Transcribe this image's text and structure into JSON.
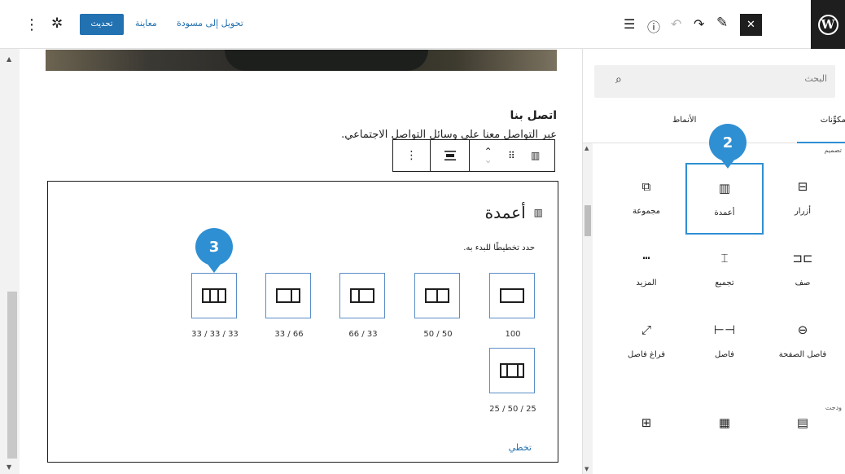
{
  "topbar": {
    "update_label": "تحديث",
    "preview_label": "معاينة",
    "draft_label": "تحويل إلى مسودة",
    "accent": "#2271b1"
  },
  "content": {
    "contact_title": "اتصل بنا",
    "contact_text": "عبر التواصل معنا على وسائل التواصل الاجتماعي."
  },
  "columns_block": {
    "title": "أعمدة",
    "instruction": "حدد تخطيطًا للبدء به.",
    "variations": [
      {
        "label": "100"
      },
      {
        "label": "50 / 50"
      },
      {
        "label": "66 / 33"
      },
      {
        "label": "33 / 66"
      },
      {
        "label": "33 / 33 / 33"
      },
      {
        "label": "25 / 50 / 25"
      }
    ],
    "skip_label": "تخطي"
  },
  "sidebar": {
    "search_placeholder": "البحث",
    "tabs": [
      {
        "label": "مكوِّنات"
      },
      {
        "label": "الأنماط"
      }
    ],
    "categories": {
      "design": "تصميم",
      "widgets": "ودجت"
    },
    "blocks": [
      {
        "label": "أزرار",
        "icon": "buttons-icon"
      },
      {
        "label": "أعمدة",
        "icon": "columns-icon",
        "selected": true
      },
      {
        "label": "مجموعة",
        "icon": "group-icon"
      },
      {
        "label": "صف",
        "icon": "row-icon"
      },
      {
        "label": "تجميع",
        "icon": "stack-icon"
      },
      {
        "label": "المزيد",
        "icon": "more-icon"
      },
      {
        "label": "فاصل الصفحة",
        "icon": "page-break-icon"
      },
      {
        "label": "فاصل",
        "icon": "separator-icon"
      },
      {
        "label": "فراغ فاصل",
        "icon": "spacer-icon"
      }
    ]
  },
  "callouts": [
    "2",
    "3"
  ],
  "callout_color": "#2f8fd3"
}
